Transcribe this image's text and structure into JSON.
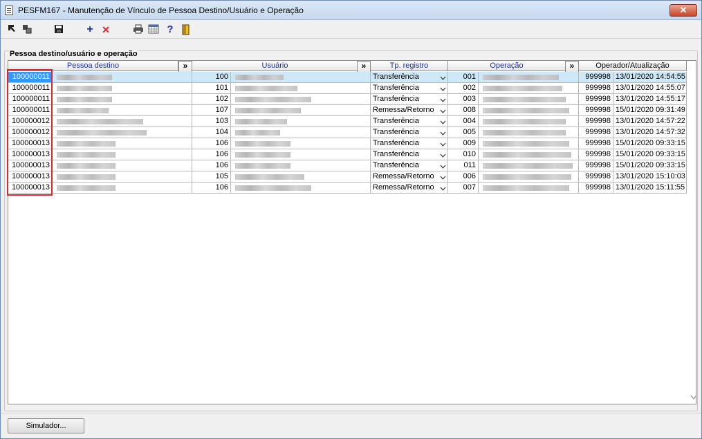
{
  "window": {
    "title": "PESFM167 - Manutenção de Vínculo de Pessoa Destino/Usuário e Operação",
    "close_label": "✕"
  },
  "toolbar": {
    "icons": [
      "first-record-icon",
      "copy-records-icon",
      "save-icon",
      "add-icon",
      "delete-icon",
      "print-icon",
      "calendar-grid-icon",
      "help-icon",
      "exit-icon"
    ]
  },
  "group": {
    "label": "Pessoa destino/usuário e operação"
  },
  "grid": {
    "headers": {
      "pessoa": "Pessoa destino",
      "usuario": "Usuário",
      "tipo": "Tp. registro",
      "operacao": "Operação",
      "operador": "Operador/Atualização",
      "expand": "»"
    },
    "rows": [
      {
        "pessoa": "100000011",
        "usuario": "100",
        "tipo": "Transferência",
        "op": "001",
        "operador": "999998",
        "data": "13/01/2020 14:54:55"
      },
      {
        "pessoa": "100000011",
        "usuario": "101",
        "tipo": "Transferência",
        "op": "002",
        "operador": "999998",
        "data": "13/01/2020 14:55:07"
      },
      {
        "pessoa": "100000011",
        "usuario": "102",
        "tipo": "Transferência",
        "op": "003",
        "operador": "999998",
        "data": "13/01/2020 14:55:17"
      },
      {
        "pessoa": "100000011",
        "usuario": "107",
        "tipo": "Remessa/Retorno",
        "op": "008",
        "operador": "999998",
        "data": "15/01/2020 09:31:49"
      },
      {
        "pessoa": "100000012",
        "usuario": "103",
        "tipo": "Transferência",
        "op": "004",
        "operador": "999998",
        "data": "13/01/2020 14:57:22"
      },
      {
        "pessoa": "100000012",
        "usuario": "104",
        "tipo": "Transferência",
        "op": "005",
        "operador": "999998",
        "data": "13/01/2020 14:57:32"
      },
      {
        "pessoa": "100000013",
        "usuario": "106",
        "tipo": "Transferência",
        "op": "009",
        "operador": "999998",
        "data": "15/01/2020 09:33:15"
      },
      {
        "pessoa": "100000013",
        "usuario": "106",
        "tipo": "Transferência",
        "op": "010",
        "operador": "999998",
        "data": "15/01/2020 09:33:15"
      },
      {
        "pessoa": "100000013",
        "usuario": "106",
        "tipo": "Transferência",
        "op": "011",
        "operador": "999998",
        "data": "15/01/2020 09:33:15"
      },
      {
        "pessoa": "100000013",
        "usuario": "105",
        "tipo": "Remessa/Retorno",
        "op": "006",
        "operador": "999998",
        "data": "13/01/2020 15:10:03"
      },
      {
        "pessoa": "100000013",
        "usuario": "106",
        "tipo": "Remessa/Retorno",
        "op": "007",
        "operador": "999998",
        "data": "13/01/2020 15:11:55"
      }
    ]
  },
  "footer": {
    "simulator_label": "Simulador..."
  },
  "colors": {
    "header_text": "#1a2fa3",
    "selected_row": "#cfe8f8",
    "highlight_border": "#e0262b",
    "current_cell": "#3399ff"
  }
}
